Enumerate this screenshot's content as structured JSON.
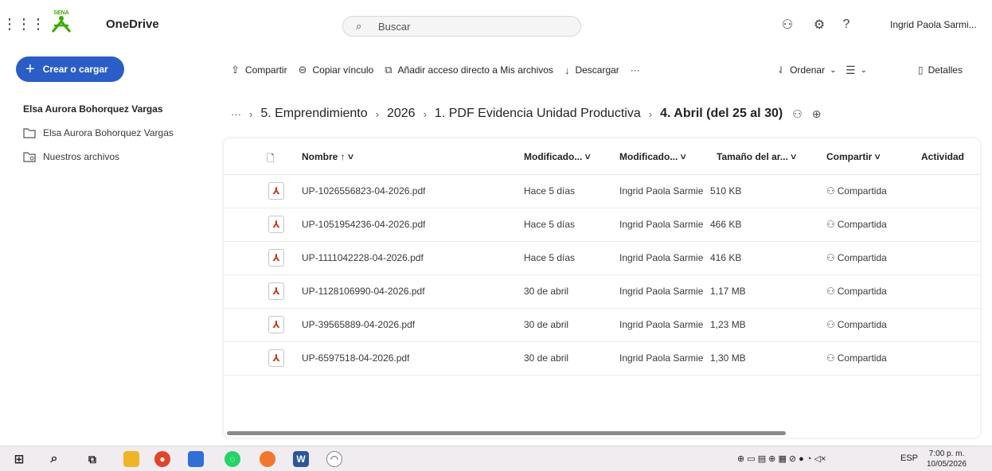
{
  "header": {
    "app_name": "OneDrive",
    "search_placeholder": "Buscar",
    "user_name": "Ingrid Paola Sarmi..."
  },
  "nav": {
    "create_label": "Crear o cargar",
    "owner": "Elsa Aurora Bohorquez Vargas",
    "items": [
      {
        "label": "Elsa Aurora Bohorquez Vargas",
        "icon": "folder-icon"
      },
      {
        "label": "Nuestros archivos",
        "icon": "shared-folder-icon"
      }
    ]
  },
  "commands": {
    "share": "Compartir",
    "copy_link": "Copiar vínculo",
    "add_shortcut": "Añadir acceso directo a Mis archivos",
    "download": "Descargar",
    "more": "···",
    "sort": "Ordenar",
    "details": "Detalles"
  },
  "breadcrumb": {
    "ellipsis": "···",
    "items": [
      "5. Emprendimiento",
      "2026",
      "1. PDF Evidencia Unidad Productiva"
    ],
    "current": "4. Abril (del 25 al 30)"
  },
  "table": {
    "columns": {
      "name": "Nombre ↑ ˅",
      "modified": "Modificado... ˅",
      "modified_by": "Modificado... ˅",
      "size": "Tamaño del ar... ˅",
      "sharing": "Compartir ˅",
      "activity": "Actividad"
    },
    "rows": [
      {
        "name": "UP-1026556823-04-2026.pdf",
        "modified": "Hace 5 días",
        "modified_by": "Ingrid Paola Sarmie",
        "size": "510 KB",
        "sharing": "Compartida"
      },
      {
        "name": "UP-1051954236-04-2026.pdf",
        "modified": "Hace 5 días",
        "modified_by": "Ingrid Paola Sarmie",
        "size": "466 KB",
        "sharing": "Compartida"
      },
      {
        "name": "UP-1111042228-04-2026.pdf",
        "modified": "Hace 5 días",
        "modified_by": "Ingrid Paola Sarmie",
        "size": "416 KB",
        "sharing": "Compartida"
      },
      {
        "name": "UP-1128106990-04-2026.pdf",
        "modified": "30 de abril",
        "modified_by": "Ingrid Paola Sarmie",
        "size": "1,17 MB",
        "sharing": "Compartida"
      },
      {
        "name": "UP-39565889-04-2026.pdf",
        "modified": "30 de abril",
        "modified_by": "Ingrid Paola Sarmie",
        "size": "1,23 MB",
        "sharing": "Compartida"
      },
      {
        "name": "UP-6597518-04-2026.pdf",
        "modified": "30 de abril",
        "modified_by": "Ingrid Paola Sarmie",
        "size": "1,30 MB",
        "sharing": "Compartida"
      }
    ]
  },
  "taskbar": {
    "language": "ESP",
    "time": "7:00 p. m.",
    "date": "10/05/2026"
  },
  "colors": {
    "accent": "#2a5ec6",
    "pdf": "#c43e1c"
  }
}
